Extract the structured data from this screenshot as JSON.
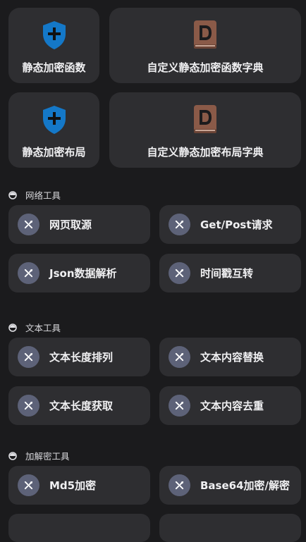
{
  "top_cards": [
    {
      "label": "静态加密函数",
      "icon": "shield-plus-icon"
    },
    {
      "label": "自定义静态加密函数字典",
      "icon": "dictionary-book-icon"
    },
    {
      "label": "静态加密布局",
      "icon": "shield-plus-icon"
    },
    {
      "label": "自定义静态加密布局字典",
      "icon": "dictionary-book-icon"
    }
  ],
  "sections": [
    {
      "title": "网络工具",
      "items": [
        "网页取源",
        "Get/Post请求",
        "Json数据解析",
        "时间戳互转"
      ]
    },
    {
      "title": "文本工具",
      "items": [
        "文本长度排列",
        "文本内容替换",
        "文本长度获取",
        "文本内容去重"
      ]
    },
    {
      "title": "加解密工具",
      "items": [
        "Md5加密",
        "Base64加密/解密"
      ]
    }
  ],
  "colors": {
    "background": "#1b1b1d",
    "card": "#2e2e31",
    "shield": "#1478c8",
    "book": "#8a5a48",
    "tool_circle": "#5d6278"
  }
}
